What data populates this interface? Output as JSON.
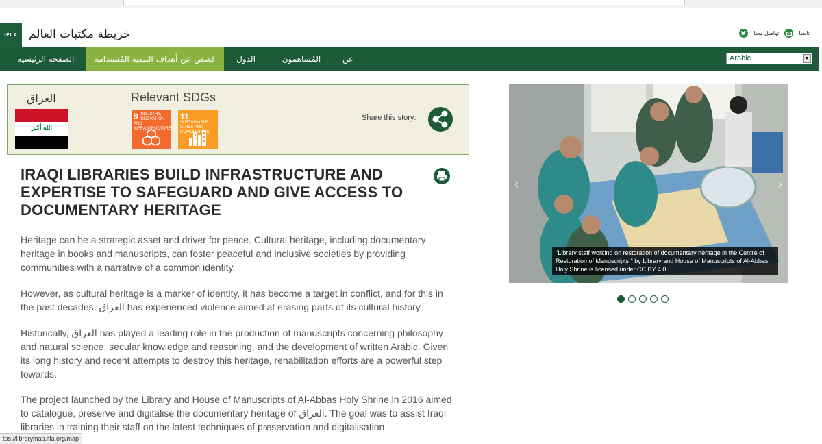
{
  "header": {
    "logo_text": "IFLA",
    "site_title": "خريطة مكتبات العالم",
    "social": [
      {
        "label": "تابعنا",
        "icon": "follow-text"
      },
      {
        "label": "تواصل معنا",
        "icon": "mail-icon"
      },
      {
        "label": "",
        "icon": "twitter-icon"
      }
    ]
  },
  "nav": {
    "items": [
      {
        "label": "الصفحة الرئيسية"
      },
      {
        "label": "قصص عن أهداف التنمية المُستدامة"
      },
      {
        "label": "الدول"
      },
      {
        "label": "المُساهمون"
      },
      {
        "label": "عن"
      }
    ],
    "language": "Arabic"
  },
  "story_meta": {
    "country": "العراق",
    "flag_text": "الله أكبر",
    "sdg_title": "Relevant SDGs",
    "sdgs": [
      {
        "number": "9",
        "label": "INDUSTRY, INNOVATION AND INFRASTRUCTURE",
        "color": "#f26a2d"
      },
      {
        "number": "11",
        "label": "SUSTAINABLE CITIES AND COMMUNITIES",
        "color": "#f99d26"
      }
    ],
    "share_label": "Share this story:"
  },
  "article": {
    "title": "IRAQI LIBRARIES BUILD INFRASTRUCTURE AND EXPERTISE TO SAFEGUARD AND GIVE ACCESS TO DOCUMENTARY HERITAGE",
    "paragraphs": [
      "Heritage can be a strategic asset and driver for peace. Cultural heritage, including documentary heritage in books and manuscripts, can foster peaceful and inclusive societies by providing communities with a narrative of a common identity.",
      "However, as cultural heritage is a marker of identity, it has become a target in conflict, and for this in the past decades, العراق has experienced violence aimed at erasing parts of its cultural history.",
      "Historically, العراق has played a leading role in the production of manuscripts concerning philosophy and natural science, secular knowledge and reasoning, and the development of written Arabic. Given its long history and recent attempts to destroy this heritage, rehabilitation efforts are a powerful step towards.",
      "The project launched by the Library and House of Manuscripts of Al-Abbas Holy Shrine in 2016 aimed to catalogue, preserve and digitalise the documentary heritage of العراق. The goal was to assist Iraqi libraries in training their staff on the latest techniques of preservation and digitalisation."
    ]
  },
  "gallery": {
    "caption": "\"Library staff working on restoration of documentary heritage in the Centre of Restoration of Manuscripts \" by Library and House of Manuscripts of Al-Abbas Holy Shrine is licensed under CC BY 4.0",
    "slide_count": 5,
    "active_slide": 1,
    "prev_label": "‹",
    "next_label": "›"
  },
  "status_bar": {
    "url": "tps://librarymap.ifla.org/map"
  },
  "colors": {
    "nav_green": "#1d5a37",
    "active_tab": "#8bb341",
    "panel_bg": "#f1efe0"
  }
}
